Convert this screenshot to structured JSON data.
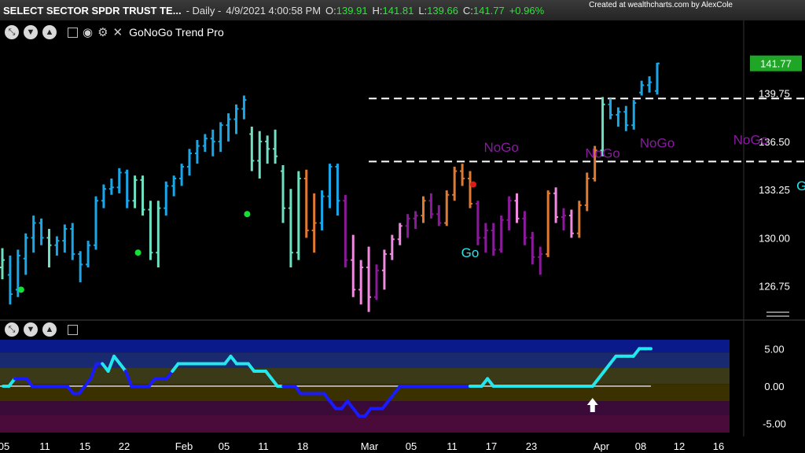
{
  "header": {
    "title": "SELECT SECTOR SPDR TRUST TE...",
    "interval": "- Daily -",
    "datetime": "4/9/2021 4:00:58 PM",
    "open_label": "O:",
    "open": "139.91",
    "high_label": "H:",
    "high": "141.81",
    "low_label": "L:",
    "low": "139.66",
    "close_label": "C:",
    "close": "141.77",
    "change": "+0.96%",
    "credit": "Created at wealthcharts.com by AlexCole"
  },
  "toolbar": {
    "indicator_name": "GoNoGo Trend Pro",
    "icons": [
      "maximize-icon",
      "chevron-down-icon",
      "chevron-up-icon",
      "collapse-icon",
      "eye-icon",
      "gear-icon",
      "close-icon"
    ]
  },
  "colors": {
    "go_strong": "#1aa7e8",
    "go": "#6fe0c0",
    "nogo_weak": "#e07a30",
    "nogo": "#f08ae0",
    "nogo_strong": "#8a1a9a",
    "osc_blue": "#1a1aff",
    "osc_cyan": "#22e8ee",
    "price_tag": "#1fa626"
  },
  "chart_data": [
    {
      "type": "ohlc",
      "title": "GoNoGo Trend Pro",
      "ylim": [
        124.5,
        143.5
      ],
      "y_ticks": [
        "126.75",
        "130.00",
        "133.25",
        "136.50",
        "139.75"
      ],
      "last_price": "141.77",
      "x_ticks": [
        "05",
        "11",
        "15",
        "22",
        "Feb",
        "05",
        "11",
        "18",
        "Mar",
        "05",
        "11",
        "17",
        "23",
        "Apr",
        "08",
        "12",
        "16"
      ],
      "bars": [
        {
          "o": 128.0,
          "h": 129.3,
          "l": 127.2,
          "c": 128.5,
          "t": "go"
        },
        {
          "o": 127.5,
          "h": 128.8,
          "l": 125.5,
          "c": 126.2,
          "t": "go_strong"
        },
        {
          "o": 126.5,
          "h": 129.2,
          "l": 126.0,
          "c": 128.8,
          "t": "go_strong"
        },
        {
          "o": 128.6,
          "h": 130.3,
          "l": 127.5,
          "c": 130.0,
          "t": "go_strong"
        },
        {
          "o": 130.0,
          "h": 131.5,
          "l": 129.0,
          "c": 131.0,
          "t": "go_strong"
        },
        {
          "o": 131.0,
          "h": 131.3,
          "l": 129.5,
          "c": 130.0,
          "t": "go_strong"
        },
        {
          "o": 130.0,
          "h": 130.6,
          "l": 128.0,
          "c": 129.5,
          "t": "go"
        },
        {
          "o": 129.5,
          "h": 130.1,
          "l": 128.8,
          "c": 129.8,
          "t": "go_strong"
        },
        {
          "o": 129.8,
          "h": 130.9,
          "l": 129.0,
          "c": 130.6,
          "t": "go_strong"
        },
        {
          "o": 130.6,
          "h": 131.0,
          "l": 128.5,
          "c": 128.9,
          "t": "go_strong"
        },
        {
          "o": 128.9,
          "h": 129.1,
          "l": 127.0,
          "c": 128.2,
          "t": "go_strong"
        },
        {
          "o": 128.2,
          "h": 129.8,
          "l": 128.0,
          "c": 129.5,
          "t": "go_strong"
        },
        {
          "o": 129.5,
          "h": 132.8,
          "l": 129.2,
          "c": 132.5,
          "t": "go_strong"
        },
        {
          "o": 132.5,
          "h": 133.6,
          "l": 132.0,
          "c": 133.3,
          "t": "go_strong"
        },
        {
          "o": 133.3,
          "h": 134.0,
          "l": 132.9,
          "c": 133.4,
          "t": "go_strong"
        },
        {
          "o": 133.4,
          "h": 134.7,
          "l": 133.0,
          "c": 134.4,
          "t": "go_strong"
        },
        {
          "o": 134.4,
          "h": 134.6,
          "l": 132.0,
          "c": 132.5,
          "t": "go_strong"
        },
        {
          "o": 132.5,
          "h": 134.2,
          "l": 132.0,
          "c": 133.9,
          "t": "go"
        },
        {
          "o": 133.9,
          "h": 134.2,
          "l": 131.5,
          "c": 131.9,
          "t": "go"
        },
        {
          "o": 131.9,
          "h": 132.5,
          "l": 128.5,
          "c": 129.0,
          "t": "go"
        },
        {
          "o": 129.0,
          "h": 132.5,
          "l": 128.0,
          "c": 132.0,
          "t": "go"
        },
        {
          "o": 132.0,
          "h": 133.8,
          "l": 131.5,
          "c": 133.5,
          "t": "go_strong"
        },
        {
          "o": 133.5,
          "h": 134.2,
          "l": 132.8,
          "c": 134.0,
          "t": "go_strong"
        },
        {
          "o": 134.0,
          "h": 135.0,
          "l": 133.5,
          "c": 134.8,
          "t": "go_strong"
        },
        {
          "o": 134.8,
          "h": 136.0,
          "l": 134.2,
          "c": 135.7,
          "t": "go_strong"
        },
        {
          "o": 135.7,
          "h": 136.6,
          "l": 135.0,
          "c": 136.2,
          "t": "go_strong"
        },
        {
          "o": 136.2,
          "h": 137.0,
          "l": 135.8,
          "c": 136.7,
          "t": "go_strong"
        },
        {
          "o": 136.7,
          "h": 137.3,
          "l": 135.5,
          "c": 136.5,
          "t": "go_strong"
        },
        {
          "o": 136.5,
          "h": 137.8,
          "l": 135.8,
          "c": 137.6,
          "t": "go_strong"
        },
        {
          "o": 137.6,
          "h": 138.4,
          "l": 136.5,
          "c": 138.0,
          "t": "go_strong"
        },
        {
          "o": 138.0,
          "h": 139.0,
          "l": 137.0,
          "c": 138.7,
          "t": "go_strong"
        },
        {
          "o": 138.7,
          "h": 139.6,
          "l": 138.0,
          "c": 139.3,
          "t": "go_strong"
        },
        {
          "o": 137.0,
          "h": 137.5,
          "l": 134.5,
          "c": 135.2,
          "t": "go"
        },
        {
          "o": 135.2,
          "h": 137.2,
          "l": 134.0,
          "c": 136.5,
          "t": "go"
        },
        {
          "o": 136.5,
          "h": 136.9,
          "l": 135.0,
          "c": 136.0,
          "t": "go"
        },
        {
          "o": 136.0,
          "h": 137.3,
          "l": 135.0,
          "c": 135.5,
          "t": "go"
        },
        {
          "o": 134.5,
          "h": 134.9,
          "l": 131.0,
          "c": 132.0,
          "t": "go"
        },
        {
          "o": 132.0,
          "h": 133.3,
          "l": 128.0,
          "c": 129.0,
          "t": "go"
        },
        {
          "o": 129.0,
          "h": 134.5,
          "l": 128.5,
          "c": 134.0,
          "t": "go"
        },
        {
          "o": 134.0,
          "h": 134.6,
          "l": 130.0,
          "c": 130.5,
          "t": "nogo_weak"
        },
        {
          "o": 130.5,
          "h": 133.0,
          "l": 129.0,
          "c": 131.0,
          "t": "nogo_weak"
        },
        {
          "o": 131.0,
          "h": 133.2,
          "l": 130.5,
          "c": 132.8,
          "t": "go_strong"
        },
        {
          "o": 132.8,
          "h": 135.0,
          "l": 132.0,
          "c": 134.8,
          "t": "go_strong"
        },
        {
          "o": 134.8,
          "h": 135.0,
          "l": 131.5,
          "c": 132.5,
          "t": "go_strong"
        },
        {
          "o": 132.5,
          "h": 132.9,
          "l": 128.0,
          "c": 128.5,
          "t": "nogo_strong"
        },
        {
          "o": 128.5,
          "h": 130.2,
          "l": 126.0,
          "c": 126.5,
          "t": "nogo"
        },
        {
          "o": 126.5,
          "h": 128.5,
          "l": 125.5,
          "c": 128.0,
          "t": "nogo"
        },
        {
          "o": 128.0,
          "h": 129.4,
          "l": 125.0,
          "c": 126.0,
          "t": "nogo"
        },
        {
          "o": 126.0,
          "h": 128.2,
          "l": 125.8,
          "c": 127.8,
          "t": "nogo_strong"
        },
        {
          "o": 127.8,
          "h": 129.2,
          "l": 126.5,
          "c": 128.9,
          "t": "nogo"
        },
        {
          "o": 128.9,
          "h": 130.2,
          "l": 128.5,
          "c": 129.9,
          "t": "nogo"
        },
        {
          "o": 129.9,
          "h": 131.0,
          "l": 129.5,
          "c": 130.8,
          "t": "nogo"
        },
        {
          "o": 130.8,
          "h": 131.6,
          "l": 130.0,
          "c": 131.3,
          "t": "nogo_strong"
        },
        {
          "o": 131.3,
          "h": 131.8,
          "l": 130.6,
          "c": 131.5,
          "t": "nogo_strong"
        },
        {
          "o": 131.5,
          "h": 132.8,
          "l": 131.0,
          "c": 132.5,
          "t": "nogo_weak"
        },
        {
          "o": 132.5,
          "h": 133.0,
          "l": 131.3,
          "c": 131.6,
          "t": "nogo_strong"
        },
        {
          "o": 131.6,
          "h": 132.2,
          "l": 130.8,
          "c": 131.0,
          "t": "nogo_strong"
        },
        {
          "o": 131.0,
          "h": 133.2,
          "l": 130.8,
          "c": 132.9,
          "t": "nogo_weak"
        },
        {
          "o": 132.9,
          "h": 134.8,
          "l": 132.5,
          "c": 134.5,
          "t": "nogo_weak"
        },
        {
          "o": 134.5,
          "h": 135.0,
          "l": 133.5,
          "c": 134.0,
          "t": "nogo_weak"
        },
        {
          "o": 134.0,
          "h": 134.5,
          "l": 132.0,
          "c": 132.3,
          "t": "nogo_weak"
        },
        {
          "o": 132.3,
          "h": 132.5,
          "l": 129.5,
          "c": 130.0,
          "t": "nogo_strong"
        },
        {
          "o": 130.0,
          "h": 131.0,
          "l": 129.0,
          "c": 130.5,
          "t": "nogo_strong"
        },
        {
          "o": 130.5,
          "h": 131.0,
          "l": 128.8,
          "c": 129.2,
          "t": "nogo_strong"
        },
        {
          "o": 129.2,
          "h": 131.5,
          "l": 129.0,
          "c": 131.2,
          "t": "nogo_strong"
        },
        {
          "o": 131.2,
          "h": 132.8,
          "l": 130.5,
          "c": 132.5,
          "t": "nogo_strong"
        },
        {
          "o": 132.5,
          "h": 133.0,
          "l": 131.0,
          "c": 131.3,
          "t": "nogo"
        },
        {
          "o": 131.3,
          "h": 131.8,
          "l": 129.5,
          "c": 130.0,
          "t": "nogo_strong"
        },
        {
          "o": 130.0,
          "h": 130.4,
          "l": 128.2,
          "c": 128.7,
          "t": "nogo_strong"
        },
        {
          "o": 128.7,
          "h": 129.4,
          "l": 127.5,
          "c": 128.9,
          "t": "nogo_strong"
        },
        {
          "o": 128.9,
          "h": 133.2,
          "l": 128.7,
          "c": 133.0,
          "t": "nogo_weak"
        },
        {
          "o": 133.0,
          "h": 133.4,
          "l": 131.0,
          "c": 131.4,
          "t": "nogo"
        },
        {
          "o": 131.4,
          "h": 132.0,
          "l": 130.5,
          "c": 131.5,
          "t": "nogo_strong"
        },
        {
          "o": 131.5,
          "h": 131.9,
          "l": 130.0,
          "c": 130.3,
          "t": "nogo"
        },
        {
          "o": 130.3,
          "h": 132.5,
          "l": 130.0,
          "c": 132.2,
          "t": "nogo_weak"
        },
        {
          "o": 132.2,
          "h": 134.4,
          "l": 131.8,
          "c": 134.0,
          "t": "nogo_weak"
        },
        {
          "o": 134.0,
          "h": 136.2,
          "l": 133.8,
          "c": 135.9,
          "t": "nogo_weak"
        },
        {
          "o": 135.9,
          "h": 139.5,
          "l": 135.5,
          "c": 139.0,
          "t": "go"
        },
        {
          "o": 139.0,
          "h": 139.4,
          "l": 138.0,
          "c": 138.3,
          "t": "go_strong"
        },
        {
          "o": 138.3,
          "h": 138.8,
          "l": 137.5,
          "c": 138.5,
          "t": "go_strong"
        },
        {
          "o": 138.5,
          "h": 138.9,
          "l": 137.2,
          "c": 137.6,
          "t": "go_strong"
        },
        {
          "o": 137.6,
          "h": 139.3,
          "l": 137.3,
          "c": 139.1,
          "t": "go_strong"
        },
        {
          "o": 139.8,
          "h": 140.6,
          "l": 139.6,
          "c": 140.3,
          "t": "go_strong"
        },
        {
          "o": 140.3,
          "h": 140.9,
          "l": 139.8,
          "c": 140.5,
          "t": "go_strong"
        },
        {
          "o": 139.91,
          "h": 141.81,
          "l": 139.66,
          "c": 141.77,
          "t": "go_strong"
        }
      ],
      "dots": [
        {
          "i": 2,
          "y": 126.5,
          "color": "#12e032"
        },
        {
          "i": 17,
          "y": 129.0,
          "color": "#12e032"
        },
        {
          "i": 31,
          "y": 131.6,
          "color": "#12e032"
        },
        {
          "i": 60,
          "y": 133.6,
          "color": "#e01a1a"
        }
      ],
      "levels": [
        {
          "y": 139.4,
          "i_from": 47,
          "i_to": 111
        },
        {
          "y": 135.15,
          "i_from": 47,
          "i_to": 111
        }
      ],
      "annotations": [
        {
          "text": "Go",
          "i": 60,
          "y": 128.7,
          "color": "#22e8ee"
        },
        {
          "text": "NoGo",
          "i": 64,
          "y": 135.8,
          "color": "#8a1aa0"
        },
        {
          "text": "NoGo",
          "i": 77,
          "y": 135.4,
          "color": "#8a1aa0"
        },
        {
          "text": "NoGo",
          "i": 84,
          "y": 136.1,
          "color": "#8a1aa0"
        },
        {
          "text": "NoGo",
          "i": 96,
          "y": 136.3,
          "color": "#8a1aa0"
        },
        {
          "text": "Go",
          "i": 103,
          "y": 133.2,
          "color": "#22e8ee"
        }
      ]
    },
    {
      "type": "line",
      "title": "GoNoGo Oscillator",
      "ylim": [
        -6.2,
        6.2
      ],
      "y_ticks": [
        "5.00",
        "0.00",
        "-5.00"
      ],
      "zero_line": 0,
      "arrow_at_index": 101,
      "values": [
        0,
        0,
        1,
        1,
        1,
        0,
        0,
        0,
        0,
        0,
        0,
        0,
        -1,
        -1,
        0,
        1,
        3,
        3,
        2,
        4,
        3,
        2,
        0,
        0,
        0,
        0,
        1,
        1,
        1,
        2,
        3,
        3,
        3,
        3,
        3,
        3,
        3,
        3,
        3,
        4,
        3,
        3,
        3,
        2,
        2,
        2,
        1,
        0,
        0,
        0,
        0,
        -1,
        -1,
        -1,
        -1,
        -1,
        -2,
        -3,
        -3,
        -2,
        -3,
        -4,
        -4,
        -3,
        -3,
        -3,
        -2,
        -1,
        0,
        0,
        0,
        0,
        0,
        0,
        0,
        0,
        0,
        0,
        0,
        0,
        0,
        0,
        0,
        1,
        0,
        0,
        0,
        0,
        0,
        0,
        0,
        0,
        0,
        0,
        0,
        0,
        0,
        0,
        0,
        0,
        0,
        0,
        1,
        2,
        3,
        4,
        4,
        4,
        4,
        5,
        5,
        5
      ],
      "colors": [
        "c",
        "c",
        "b",
        "b",
        "b",
        "b",
        "b",
        "b",
        "b",
        "b",
        "b",
        "b",
        "b",
        "b",
        "b",
        "b",
        "b",
        "c",
        "c",
        "c",
        "c",
        "b",
        "b",
        "b",
        "b",
        "b",
        "b",
        "b",
        "b",
        "c",
        "c",
        "c",
        "c",
        "c",
        "c",
        "c",
        "c",
        "c",
        "c",
        "c",
        "c",
        "c",
        "c",
        "c",
        "c",
        "c",
        "c",
        "c",
        "b",
        "b",
        "b",
        "b",
        "b",
        "b",
        "b",
        "b",
        "b",
        "b",
        "b",
        "b",
        "b",
        "b",
        "b",
        "b",
        "b",
        "b",
        "b",
        "b",
        "b",
        "b",
        "b",
        "b",
        "b",
        "b",
        "b",
        "b",
        "b",
        "b",
        "b",
        "b",
        "c",
        "c",
        "c",
        "c",
        "c",
        "c",
        "c",
        "c",
        "c",
        "c",
        "c",
        "c",
        "c",
        "c",
        "c",
        "c",
        "c",
        "c",
        "c",
        "c",
        "c",
        "c",
        "c",
        "c",
        "c",
        "c",
        "c",
        "c",
        "c",
        "c",
        "c",
        "c"
      ]
    }
  ]
}
